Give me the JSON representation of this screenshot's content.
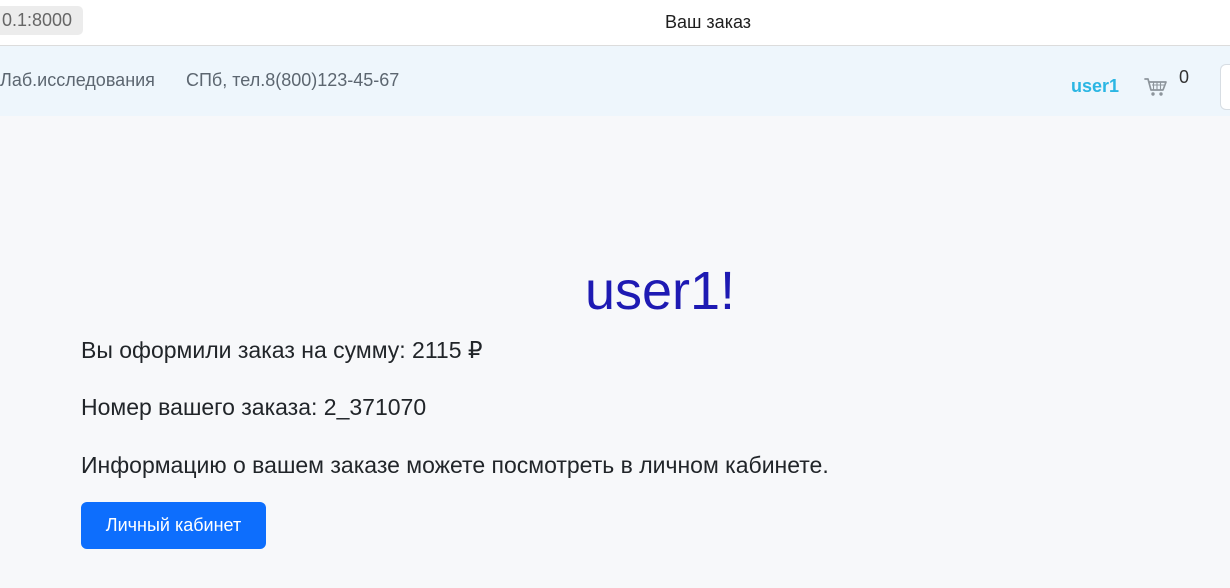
{
  "window": {
    "url": "0.1:8000",
    "title": "Ваш заказ"
  },
  "navbar": {
    "brand": "Лаб.исследования",
    "contact": "СПб, тел.8(800)123-45-67",
    "user": "user1",
    "cart_icon": "shopping-cart-icon",
    "cart_count": "0"
  },
  "main": {
    "greeting": "user1!",
    "order_sum_text": "Вы оформили заказ на сумму: 2115 ₽",
    "order_number_text": "Номер вашего заказа: 2_371070",
    "info_text": "Информацию о вашем заказе можете посмотреть в личном кабинете.",
    "cabinet_button": "Личный кабинет"
  },
  "colors": {
    "accent": "#0d6efd",
    "greeting": "#1e1ab3",
    "user_link": "#2bb6e3",
    "navbar_bg": "#eef6fc"
  }
}
